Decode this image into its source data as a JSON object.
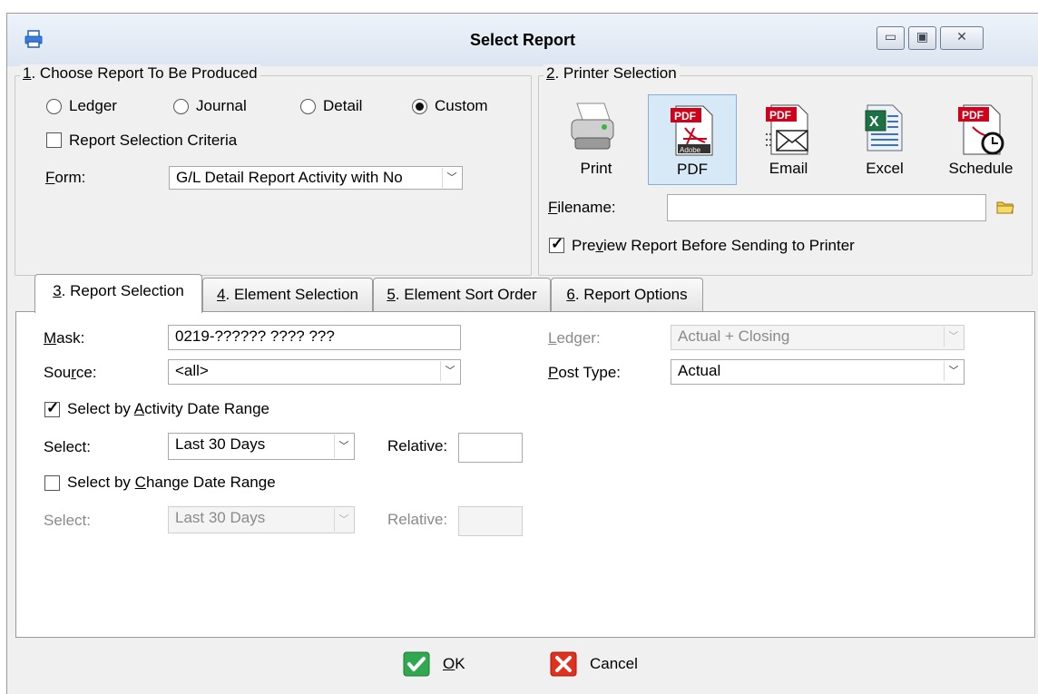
{
  "window": {
    "title": "Select Report"
  },
  "group1": {
    "legend": {
      "num": "1",
      "rest": ". Choose Report To Be Produced"
    },
    "radios": [
      {
        "label": "Ledger",
        "selected": false
      },
      {
        "label": "Journal",
        "selected": false
      },
      {
        "label": "Detail",
        "selected": false
      },
      {
        "label": "Custom",
        "selected": true
      }
    ],
    "criteria_checkbox": {
      "label": "Report Selection Criteria",
      "checked": false
    },
    "form": {
      "label_first": "F",
      "label_rest": "orm:",
      "value": "G/L Detail Report Activity with No"
    }
  },
  "group2": {
    "legend": {
      "num": "2",
      "rest": ". Printer Selection"
    },
    "buttons": [
      {
        "label": "Print",
        "icon": "printer-icon",
        "selected": false
      },
      {
        "label": "PDF",
        "icon": "pdf-icon",
        "selected": true
      },
      {
        "label": "Email",
        "icon": "email-pdf-icon",
        "selected": false
      },
      {
        "label": "Excel",
        "icon": "excel-icon",
        "selected": false
      },
      {
        "label": "Schedule",
        "icon": "schedule-pdf-icon",
        "selected": false
      }
    ],
    "filename": {
      "label_first": "F",
      "label_rest": "ilename:",
      "value": ""
    },
    "preview": {
      "label_pre": "Pre",
      "label_u": "v",
      "label_post": "iew Report Before Sending to Printer",
      "checked": true
    }
  },
  "tabs": [
    {
      "num": "3",
      "rest": ". Report Selection",
      "active": true
    },
    {
      "num": "4",
      "rest": ". Element Selection",
      "active": false
    },
    {
      "num": "5",
      "rest": ". Element Sort Order",
      "active": false
    },
    {
      "num": "6",
      "rest": ". Report Options",
      "active": false
    }
  ],
  "report_selection": {
    "mask": {
      "label_first": "M",
      "label_rest": "ask:",
      "value": "0219-?????? ???? ???"
    },
    "source": {
      "label_pre": "Sou",
      "label_u": "r",
      "label_post": "ce:",
      "value": "<all>"
    },
    "ledger": {
      "label_first": "L",
      "label_rest": "edger:",
      "value": "Actual + Closing"
    },
    "post_type": {
      "label_first": "P",
      "label_rest": "ost Type:",
      "value": "Actual"
    },
    "activity": {
      "checkbox": {
        "label_pre": "Select by ",
        "label_u": "A",
        "label_post": "ctivity Date Range",
        "checked": true
      },
      "select_label": "Select:",
      "select_value": "Last 30 Days",
      "relative_label": "Relative:",
      "relative_value": ""
    },
    "change": {
      "checkbox": {
        "label_pre": "Select by ",
        "label_u": "C",
        "label_post": "hange Date Range",
        "checked": false
      },
      "select_label": "Select:",
      "select_value": "Last 30 Days",
      "relative_label": "Relative:",
      "relative_value": ""
    }
  },
  "footer": {
    "ok": {
      "label_u": "O",
      "label_rest": "K"
    },
    "cancel": {
      "label": "Cancel"
    }
  },
  "colors": {
    "accent_selected": "#d7e8f7",
    "pdf_red": "#d0021b",
    "ok_green": "#2fa84f",
    "cancel_red": "#e0301e"
  }
}
